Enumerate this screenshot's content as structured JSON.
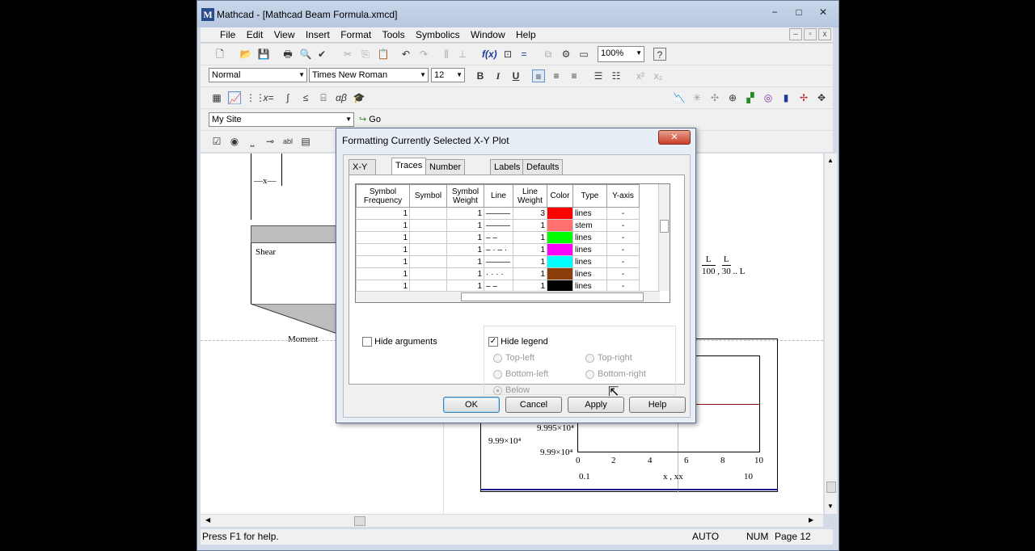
{
  "window": {
    "title": "Mathcad - [Mathcad Beam Formula.xmcd]",
    "min": "−",
    "max": "□",
    "close": "✕"
  },
  "menu": [
    "File",
    "Edit",
    "View",
    "Insert",
    "Format",
    "Tools",
    "Symbolics",
    "Window",
    "Help"
  ],
  "mdi": {
    "min": "–",
    "restore": "▫",
    "close": "x"
  },
  "toolbar": {
    "zoom": "100%",
    "style": "Normal",
    "font": "Times New Roman",
    "size": "12",
    "bold": "B",
    "italic": "I",
    "underline": "U",
    "site": "My Site",
    "go": "Go"
  },
  "status": {
    "help": "Press F1 for help.",
    "auto": "AUTO",
    "num": "NUM",
    "page": "Page 12"
  },
  "doc": {
    "shear": "Shear",
    "moment": "Moment",
    "dim": "x",
    "frac1_num": "L",
    "frac1_den": "100",
    "frac2_num": "L",
    "frac2_den": "30",
    "frac_tail": "L",
    "yaxis": [
      "9.995×10⁴",
      "9.99×10⁴"
    ],
    "ylabel_side": "9.99×10⁴",
    "xticks": [
      "0",
      "2",
      "4",
      "6",
      "8",
      "10"
    ],
    "xlabel": "x , xx",
    "xlim_lo": "0.1",
    "xlim_hi": "10"
  },
  "dialog": {
    "title": "Formatting Currently Selected X-Y Plot",
    "close": "✕",
    "tabs": [
      "X-Y Axes",
      "Traces",
      "Number Format",
      "Labels",
      "Defaults"
    ],
    "headers": [
      "Symbol Frequency",
      "Symbol",
      "Symbol Weight",
      "Line",
      "Line Weight",
      "Color",
      "Type",
      "Y-axis"
    ],
    "rows": [
      {
        "freq": "1",
        "symw": "1",
        "line": "solid",
        "lw": "3",
        "color": "#ff0000",
        "type": "lines",
        "yaxis": "-"
      },
      {
        "freq": "1",
        "symw": "1",
        "line": "solid",
        "lw": "1",
        "color": "#ff7070",
        "type": "stem",
        "yaxis": "-"
      },
      {
        "freq": "1",
        "symw": "1",
        "line": "dash",
        "lw": "1",
        "color": "#00ff00",
        "type": "lines",
        "yaxis": "-"
      },
      {
        "freq": "1",
        "symw": "1",
        "line": "dashdot",
        "lw": "1",
        "color": "#ff00ff",
        "type": "lines",
        "yaxis": "-"
      },
      {
        "freq": "1",
        "symw": "1",
        "line": "solid",
        "lw": "1",
        "color": "#00ffff",
        "type": "lines",
        "yaxis": "-"
      },
      {
        "freq": "1",
        "symw": "1",
        "line": "dot",
        "lw": "1",
        "color": "#8b3d0a",
        "type": "lines",
        "yaxis": "-"
      },
      {
        "freq": "1",
        "symw": "1",
        "line": "dash",
        "lw": "1",
        "color": "#000000",
        "type": "lines",
        "yaxis": "-"
      }
    ],
    "hide_arguments": "Hide arguments",
    "hide_legend": "Hide legend",
    "legend_pos": {
      "top_left": "Top-left",
      "top_right": "Top-right",
      "bottom_left": "Bottom-left",
      "bottom_right": "Bottom-right",
      "below": "Below"
    },
    "buttons": {
      "ok": "OK",
      "cancel": "Cancel",
      "apply": "Apply",
      "help": "Help"
    }
  }
}
